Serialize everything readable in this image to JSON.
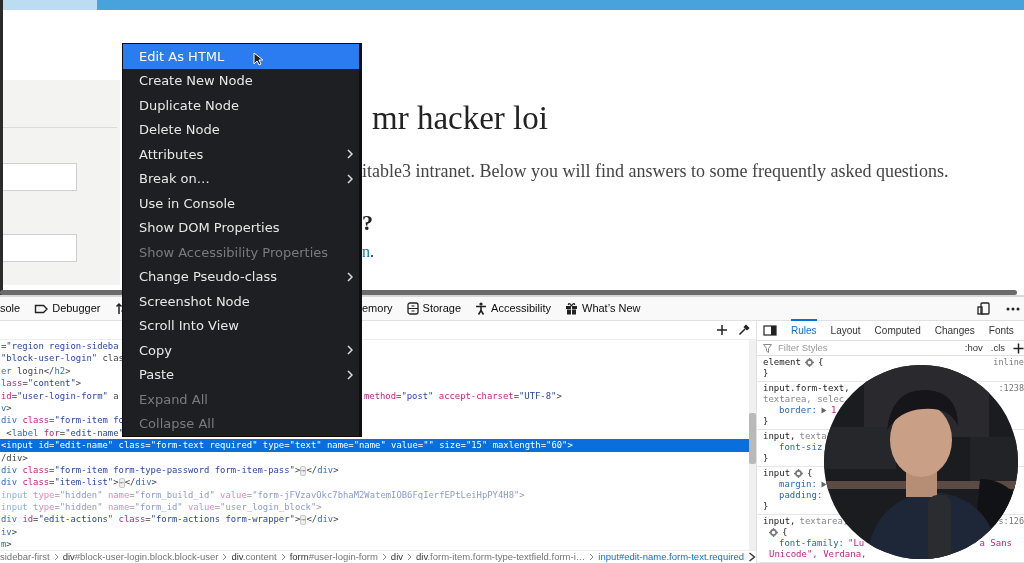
{
  "page": {
    "heading": "mr hacker loi",
    "intro": "itable3 intranet. Below you will find answers to some frequently asked questions.",
    "subheading": "?",
    "link_line": {
      "link": "n",
      "after": "."
    }
  },
  "context_menu": {
    "items": [
      {
        "label": "Edit As HTML",
        "selected": true,
        "disabled": false,
        "submenu": false
      },
      {
        "label": "Create New Node",
        "selected": false,
        "disabled": false,
        "submenu": false
      },
      {
        "label": "Duplicate Node",
        "selected": false,
        "disabled": false,
        "submenu": false
      },
      {
        "label": "Delete Node",
        "selected": false,
        "disabled": false,
        "submenu": false
      },
      {
        "label": "Attributes",
        "selected": false,
        "disabled": false,
        "submenu": true
      },
      {
        "label": "Break on…",
        "selected": false,
        "disabled": false,
        "submenu": true
      },
      {
        "label": "Use in Console",
        "selected": false,
        "disabled": false,
        "submenu": false
      },
      {
        "label": "Show DOM Properties",
        "selected": false,
        "disabled": false,
        "submenu": false
      },
      {
        "label": "Show Accessibility Properties",
        "selected": false,
        "disabled": true,
        "submenu": false
      },
      {
        "label": "Change Pseudo-class",
        "selected": false,
        "disabled": false,
        "submenu": true
      },
      {
        "label": "Screenshot Node",
        "selected": false,
        "disabled": false,
        "submenu": false
      },
      {
        "label": "Scroll Into View",
        "selected": false,
        "disabled": false,
        "submenu": false
      },
      {
        "label": "Copy",
        "selected": false,
        "disabled": false,
        "submenu": true
      },
      {
        "label": "Paste",
        "selected": false,
        "disabled": false,
        "submenu": true
      },
      {
        "label": "Expand All",
        "selected": false,
        "disabled": true,
        "submenu": false
      },
      {
        "label": "Collapse All",
        "selected": false,
        "disabled": true,
        "submenu": false
      }
    ]
  },
  "devtools": {
    "tabs_left": [
      "sole",
      "Debugger"
    ],
    "tabs_right": [
      "emory",
      "Storage",
      "Accessibility",
      "What’s New"
    ],
    "inspector": {
      "lines": [
        {
          "text": "=\"region region-sideba",
          "selected": false,
          "dimmed": false
        },
        {
          "text": "\"block-user-login\" clas",
          "selected": false,
          "dimmed": false
        },
        {
          "text": "er login</h2>",
          "selected": false,
          "dimmed": false
        },
        {
          "text": "lass=\"content\">",
          "selected": false,
          "dimmed": false
        },
        {
          "text": "id=\"user-login-form\" a",
          "tail": "method=\"post\" accept-charset=\"UTF-8\">",
          "selected": false,
          "dimmed": false
        },
        {
          "text": "v>",
          "selected": false,
          "dimmed": false
        },
        {
          "text": "div class=\"form-item fo",
          "selected": false,
          "dimmed": false
        },
        {
          "text": " <label for=\"edit-name\"",
          "selected": false,
          "dimmed": false
        },
        {
          "text": "<input id=\"edit-name\" class=\"form-text required\" type=\"text\" name=\"name\" value=\"\" size=\"15\" maxlength=\"60\">",
          "selected": true,
          "dimmed": false
        },
        {
          "text": "/div>",
          "selected": false,
          "dimmed": false
        },
        {
          "text": "div class=\"form-item form-type-password form-item-pass\">⋯</div>",
          "selected": false,
          "dimmed": false
        },
        {
          "text": "div class=\"item-list\">⋯</div>",
          "selected": false,
          "dimmed": false
        },
        {
          "text": "input type=\"hidden\" name=\"form_build_id\" value=\"form-jFVzavOkc7bhaM2WatemIOB6FqIerfEPtLeiHpPY4H8\">",
          "selected": false,
          "dimmed": true
        },
        {
          "text": "input type=\"hidden\" name=\"form_id\" value=\"user_login_block\">",
          "selected": false,
          "dimmed": true
        },
        {
          "text": "div id=\"edit-actions\" class=\"form-actions form-wrapper\">⋯</div>",
          "selected": false,
          "dimmed": false
        },
        {
          "text": "iv>",
          "selected": false,
          "dimmed": false
        },
        {
          "text": "m>",
          "selected": false,
          "dimmed": false
        }
      ],
      "breadcrumbs": [
        {
          "rest": "sidebar-first",
          "selected": false
        },
        {
          "tag": "div",
          "rest": "#block-user-login.block.block-user",
          "selected": false
        },
        {
          "tag": "div",
          "rest": ".content",
          "selected": false
        },
        {
          "tag": "form",
          "rest": "#user-login-form",
          "selected": false
        },
        {
          "tag": "div",
          "selected": false
        },
        {
          "tag": "div",
          "rest": ".form-item.form-type-textfield.form-i…",
          "selected": false
        },
        {
          "tag": "input",
          "rest": "#edit-name.form-text.required",
          "selected": true
        }
      ]
    },
    "sidebar": {
      "tabs": [
        {
          "label": "Rules",
          "selected": true
        },
        {
          "label": "Layout",
          "selected": false
        },
        {
          "label": "Computed",
          "selected": false
        },
        {
          "label": "Changes",
          "selected": false
        },
        {
          "label": "Fonts",
          "selected": false
        }
      ],
      "filter": {
        "placeholder": "Filter Styles"
      },
      "toggles": [
        ":hov",
        ".cls"
      ],
      "rules": [
        {
          "source": "inline",
          "lines": [
            {
              "kind": "selector",
              "selector": "element",
              "gear": true,
              "brace": "{"
            },
            {
              "kind": "close",
              "brace": "}"
            }
          ]
        },
        {
          "source": ":1238",
          "lines": [
            {
              "kind": "selector",
              "selector": "input.form-text,"
            },
            {
              "kind": "selector",
              "selector_dim": "textarea, selec"
            },
            {
              "kind": "declaration",
              "property": "border:",
              "twisty": true,
              "value": "1"
            },
            {
              "kind": "close",
              "brace": "}"
            }
          ]
        },
        {
          "lines": [
            {
              "kind": "selector",
              "selector": "input,",
              "selector_dim": "texta"
            },
            {
              "kind": "declaration",
              "property": "font-siz"
            },
            {
              "kind": "close",
              "brace": "}"
            }
          ]
        },
        {
          "lines": [
            {
              "kind": "selector",
              "selector": "input",
              "gear": true,
              "brace": "{"
            },
            {
              "kind": "declaration",
              "property": "margin:",
              "twisty": true
            },
            {
              "kind": "declaration",
              "property": "padding:"
            },
            {
              "kind": "close",
              "brace": "}"
            }
          ]
        },
        {
          "source": "s:126",
          "lines": [
            {
              "kind": "selector",
              "selector": "input,",
              "selector_dim": "textarea,"
            },
            {
              "kind": "continuation",
              "gear": true,
              "brace": "{"
            },
            {
              "kind": "declaration",
              "property": "font-family:",
              "value": "\"Lu",
              "tail": "a Sans"
            },
            {
              "kind": "continuation",
              "value": "Unicode\", Verdana,"
            }
          ]
        }
      ]
    }
  }
}
